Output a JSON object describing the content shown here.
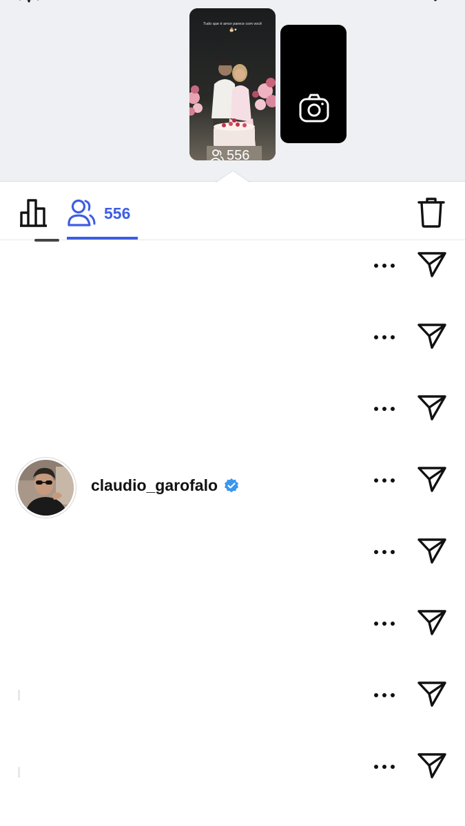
{
  "story": {
    "caption": "Tudo que é amor parece com você",
    "caption_emoji": "🎂♥",
    "viewer_count": "556",
    "icons": {
      "viewers": "people-icon",
      "camera": "camera-icon",
      "settings": "gear-icon",
      "close": "close-icon"
    }
  },
  "tabs": {
    "insights_icon": "bar-chart-icon",
    "viewers_icon": "people-icon",
    "viewers_count": "556",
    "delete_icon": "trash-icon",
    "accent_color": "#3d5de5"
  },
  "viewers": {
    "more_icon": "more-dots-icon",
    "send_icon": "send-icon",
    "rows": [
      {
        "username": ""
      },
      {
        "username": ""
      },
      {
        "username": ""
      },
      {
        "username": "claudio_garofalo",
        "verified": true
      },
      {
        "username": ""
      },
      {
        "username": ""
      },
      {
        "username": ""
      },
      {
        "username": ""
      }
    ]
  }
}
